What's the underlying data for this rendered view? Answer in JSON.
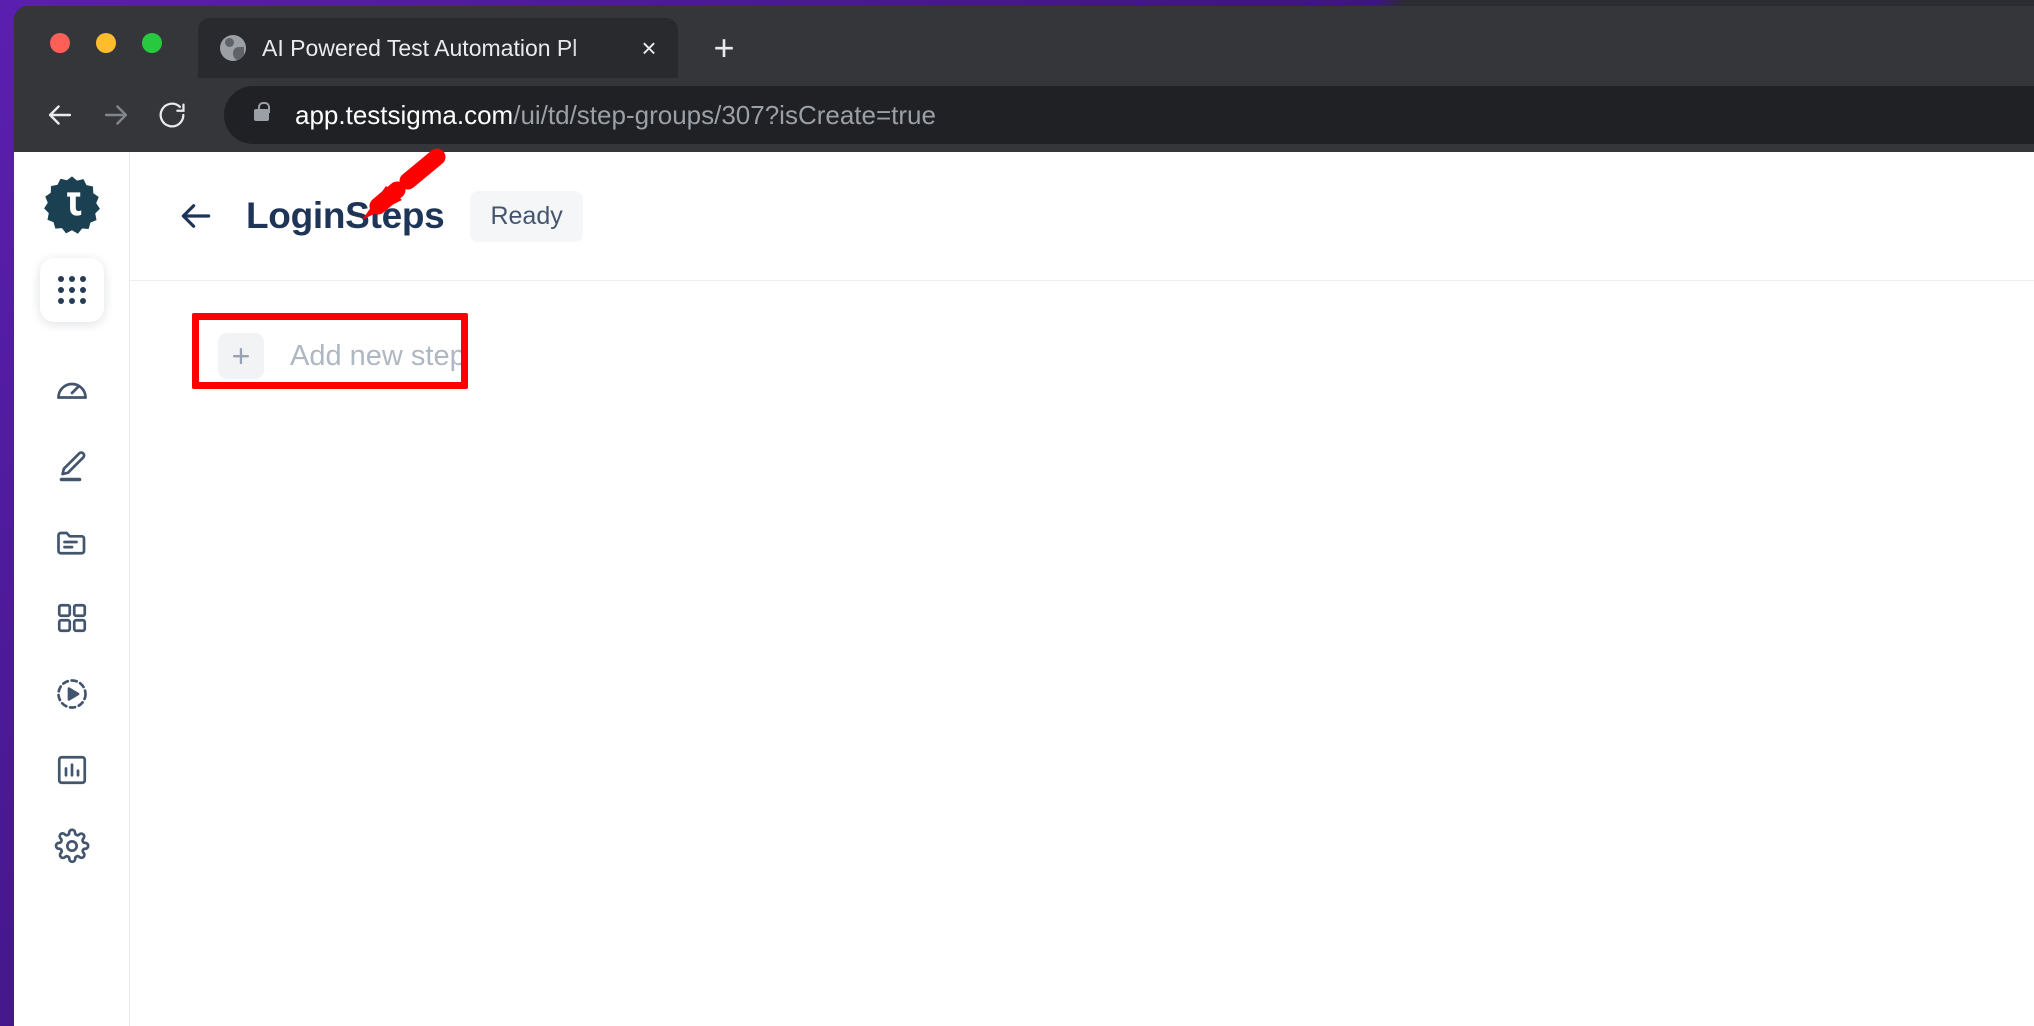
{
  "browser": {
    "window_controls": [
      "close",
      "minimize",
      "maximize"
    ],
    "tab": {
      "title": "AI Powered Test Automation Pl",
      "favicon": "globe-icon",
      "close_label": "×"
    },
    "new_tab_label": "+",
    "nav": {
      "back": "back-arrow-icon",
      "forward": "forward-arrow-icon",
      "reload": "reload-icon"
    },
    "address": {
      "lock": "lock-icon",
      "host": "app.testsigma.com",
      "path": "/ui/td/step-groups/307?isCreate=true",
      "full_url": "app.testsigma.com/ui/td/step-groups/307?isCreate=true"
    }
  },
  "sidebar": {
    "logo": "testsigma-logo-icon",
    "apps_button": "apps-grid-icon",
    "items": [
      {
        "icon": "speedometer-icon",
        "name": "dashboard"
      },
      {
        "icon": "pencil-icon",
        "name": "create-tests"
      },
      {
        "icon": "folder-icon",
        "name": "test-cases"
      },
      {
        "icon": "grid-squares-icon",
        "name": "test-suites"
      },
      {
        "icon": "play-circle-icon",
        "name": "test-plans"
      },
      {
        "icon": "bar-chart-icon",
        "name": "reports"
      },
      {
        "icon": "gear-icon",
        "name": "settings"
      }
    ]
  },
  "page": {
    "back_icon": "back-arrow-icon",
    "title": "LoginSteps",
    "status": "Ready",
    "add_step": {
      "plus": "+",
      "label": "Add new step"
    }
  },
  "annotations": {
    "highlight_color": "#ff0000",
    "arrow": "red-arrow-pointing-to-title",
    "box": "red-rectangle-around-add-new-step"
  },
  "colors": {
    "brand_dark": "#1f3557",
    "sidebar_icon": "#44556e",
    "muted_text": "#aeb7c2",
    "badge_bg": "#f4f6f8",
    "annotation_red": "#ff0000"
  }
}
